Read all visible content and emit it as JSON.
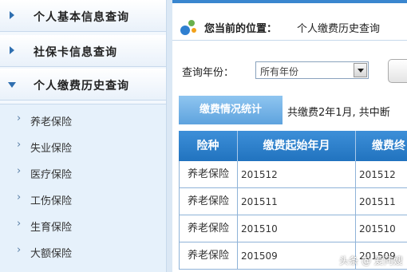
{
  "sidebar": {
    "items": [
      {
        "label": "个人基本信息查询",
        "icon": "triangle-right-icon"
      },
      {
        "label": "社保卡信息查询",
        "icon": "triangle-right-icon"
      },
      {
        "label": "个人缴费历史查询",
        "icon": "triangle-down-icon"
      }
    ],
    "sub_items": [
      {
        "label": "养老保险"
      },
      {
        "label": "失业保险"
      },
      {
        "label": "医疗保险"
      },
      {
        "label": "工伤保险"
      },
      {
        "label": "生育保险"
      },
      {
        "label": "大额保险"
      }
    ],
    "chevron": "›"
  },
  "breadcrumb": {
    "label": "您当前的位置：",
    "value": "个人缴费历史查询"
  },
  "filter": {
    "label": "查询年份：",
    "select_value": "所有年份"
  },
  "tab": {
    "label": "缴费情况统计",
    "summary": "共缴费2年1月, 共中断"
  },
  "table": {
    "headers": [
      "险种",
      "缴费起始年月",
      "缴费终"
    ],
    "rows": [
      [
        "养老保险",
        "201512",
        "201512"
      ],
      [
        "养老保险",
        "201511",
        "201511"
      ],
      [
        "养老保险",
        "201510",
        "201510"
      ],
      [
        "养老保险",
        "201509",
        "201509"
      ]
    ]
  },
  "watermark": "头条 @ 爱问嫂"
}
